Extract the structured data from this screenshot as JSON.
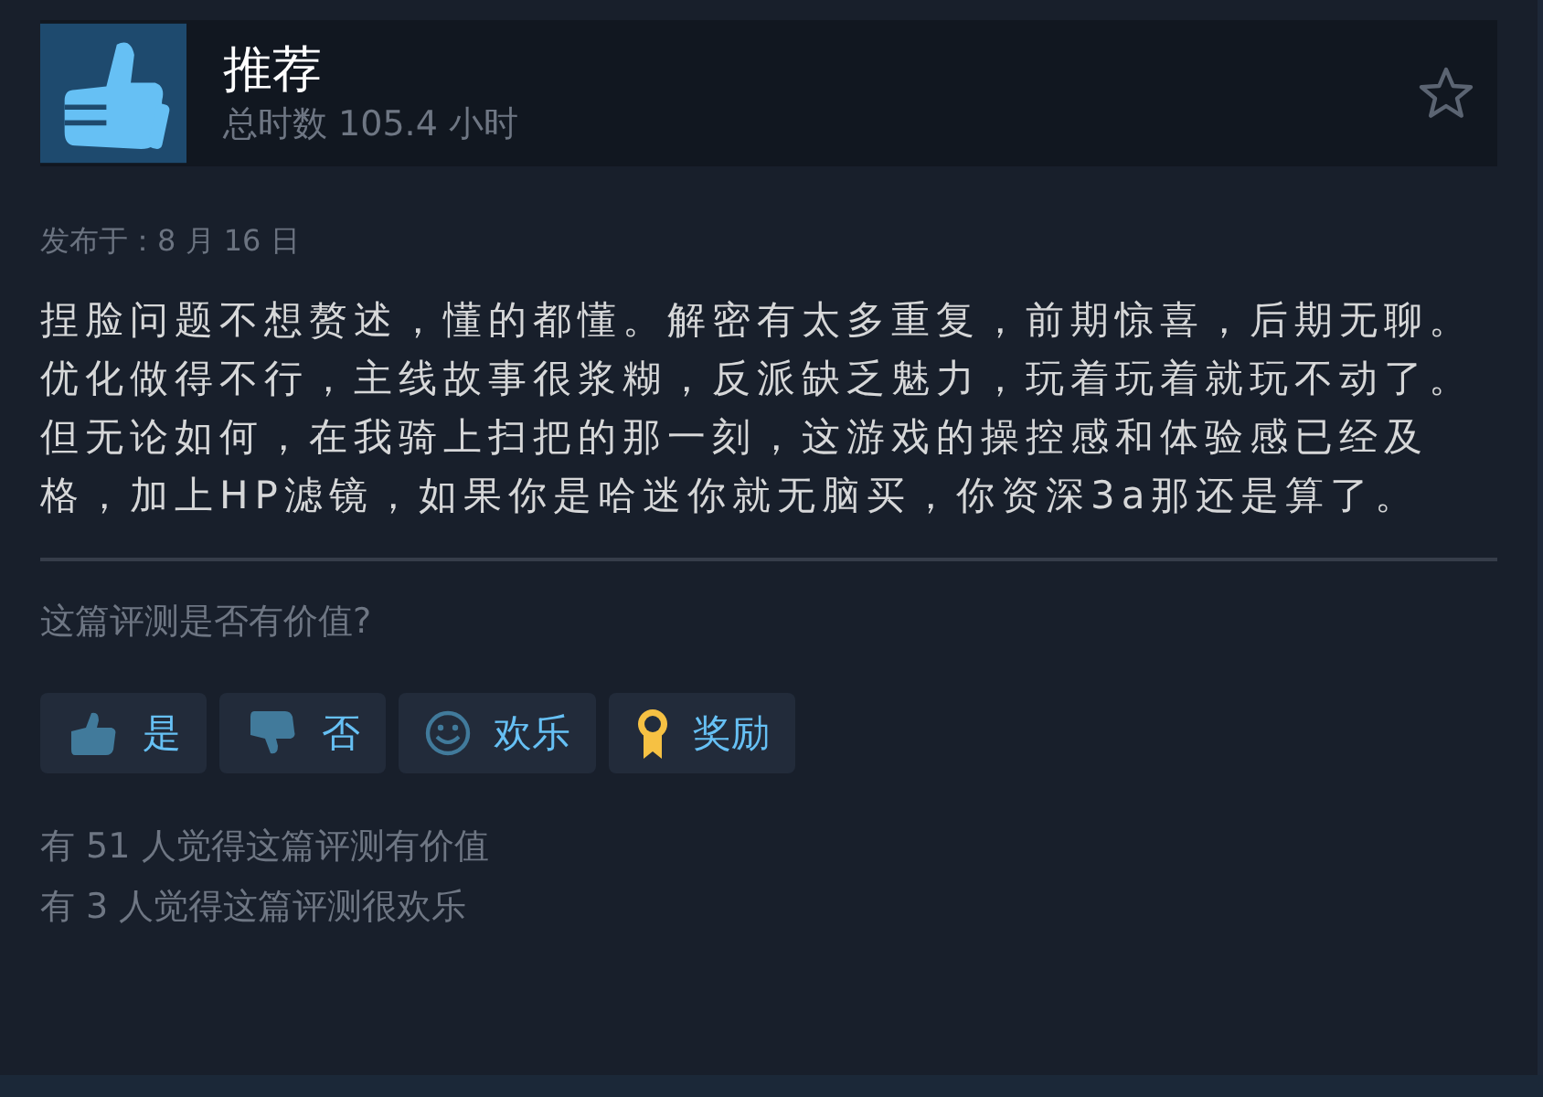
{
  "header": {
    "verdict": "推荐",
    "hours": "总时数 105.4 小时",
    "recommended": true
  },
  "posted": "发布于：8 月 16 日",
  "review_text": "捏脸问题不想赘述，懂的都懂。解密有太多重复，前期惊喜，后期无聊。优化做得不行，主线故事很浆糊，反派缺乏魅力，玩着玩着就玩不动了。但无论如何，在我骑上扫把的那一刻，这游戏的操控感和体验感已经及格，加上HP滤镜，如果你是哈迷你就无脑买，你资深3a那还是算了。",
  "question": "这篇评测是否有价值?",
  "buttons": [
    {
      "kind": "up",
      "label": "是"
    },
    {
      "kind": "down",
      "label": "否"
    },
    {
      "kind": "funny",
      "label": "欢乐"
    },
    {
      "kind": "award",
      "label": "奖励"
    }
  ],
  "stats": [
    "有 51 人觉得这篇评测有价值",
    "有 3 人觉得这篇评测很欢乐"
  ]
}
